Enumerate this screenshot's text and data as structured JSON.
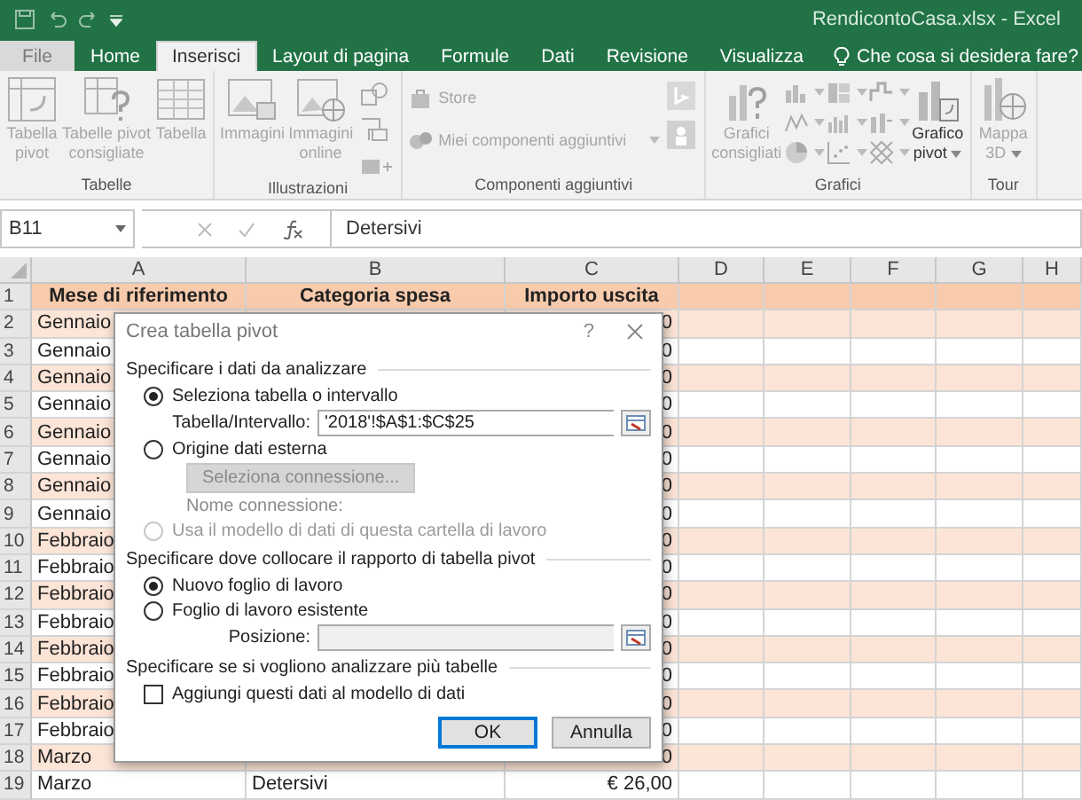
{
  "window": {
    "title": "RendicontoCasa.xlsx - Excel"
  },
  "tabs": [
    {
      "label": "File",
      "kind": "file",
      "selected": false
    },
    {
      "label": "Home",
      "kind": "tab",
      "selected": false
    },
    {
      "label": "Inserisci",
      "kind": "tab",
      "selected": true
    },
    {
      "label": "Layout di pagina",
      "kind": "tab",
      "selected": false
    },
    {
      "label": "Formule",
      "kind": "tab",
      "selected": false
    },
    {
      "label": "Dati",
      "kind": "tab",
      "selected": false
    },
    {
      "label": "Revisione",
      "kind": "tab",
      "selected": false
    },
    {
      "label": "Visualizza",
      "kind": "tab",
      "selected": false
    }
  ],
  "tell_me": {
    "placeholder": "Che cosa si desidera fare?"
  },
  "ribbon": {
    "groups": [
      {
        "label": "Tabelle",
        "items": [
          {
            "kind": "large",
            "label": "Tabella\npivot",
            "disabled": true
          },
          {
            "kind": "large",
            "label": "Tabelle pivot\nconsigliate",
            "disabled": true
          },
          {
            "kind": "large",
            "label": "Tabella",
            "disabled": true
          }
        ]
      },
      {
        "label": "Illustrazioni",
        "items": [
          {
            "kind": "large",
            "label": "Immagini",
            "disabled": true
          },
          {
            "kind": "large",
            "label": "Immagini\nonline",
            "disabled": true
          },
          {
            "kind": "icon-column"
          }
        ]
      },
      {
        "label": "Componenti aggiuntivi",
        "items": [
          {
            "kind": "small",
            "label": "Store",
            "disabled": true
          },
          {
            "kind": "small",
            "label": "Miei componenti aggiuntivi",
            "disabled": true,
            "dropdown": true
          },
          {
            "kind": "icon-column"
          }
        ]
      },
      {
        "label": "Grafici",
        "items": [
          {
            "kind": "large",
            "label": "Grafici\nconsigliati",
            "disabled": true
          },
          {
            "kind": "chart-grid"
          },
          {
            "kind": "large",
            "label": "Grafico\npivot",
            "disabled": false,
            "dropdown": true
          }
        ]
      },
      {
        "label": "Tour",
        "items": [
          {
            "kind": "large",
            "label": "Mappa\n3D",
            "disabled": true,
            "dropdown": true
          }
        ]
      }
    ]
  },
  "formula_bar": {
    "name_box": "B11",
    "formula": "Detersivi"
  },
  "sheet": {
    "columns": [
      "A",
      "B",
      "C",
      "D",
      "E",
      "F",
      "G",
      "H"
    ],
    "rows": [
      {
        "number": "1",
        "kind": "header",
        "cells": {
          "A": "Mese di riferimento",
          "B": "Categoria spesa",
          "C": "Importo uscita"
        }
      },
      {
        "number": "2",
        "kind": "band",
        "cells": {
          "A": "Gennaio",
          "C": "0"
        }
      },
      {
        "number": "3",
        "kind": "plain",
        "cells": {
          "A": "Gennaio",
          "C": "0"
        }
      },
      {
        "number": "4",
        "kind": "band",
        "cells": {
          "A": "Gennaio",
          "C": "0"
        }
      },
      {
        "number": "5",
        "kind": "plain",
        "cells": {
          "A": "Gennaio",
          "C": "0"
        }
      },
      {
        "number": "6",
        "kind": "band",
        "cells": {
          "A": "Gennaio",
          "C": "0"
        }
      },
      {
        "number": "7",
        "kind": "plain",
        "cells": {
          "A": "Gennaio",
          "C": "0"
        }
      },
      {
        "number": "8",
        "kind": "band",
        "cells": {
          "A": "Gennaio",
          "C": "0"
        }
      },
      {
        "number": "9",
        "kind": "plain",
        "cells": {
          "A": "Gennaio",
          "C": "0"
        }
      },
      {
        "number": "10",
        "kind": "band",
        "cells": {
          "A": "Febbraio",
          "C": "0"
        }
      },
      {
        "number": "11",
        "kind": "plain",
        "cells": {
          "A": "Febbraio",
          "C": "0"
        }
      },
      {
        "number": "12",
        "kind": "band",
        "cells": {
          "A": "Febbraio",
          "C": "0"
        }
      },
      {
        "number": "13",
        "kind": "plain",
        "cells": {
          "A": "Febbraio",
          "C": "0"
        }
      },
      {
        "number": "14",
        "kind": "band",
        "cells": {
          "A": "Febbraio",
          "C": "0"
        }
      },
      {
        "number": "15",
        "kind": "plain",
        "cells": {
          "A": "Febbraio",
          "C": "0"
        }
      },
      {
        "number": "16",
        "kind": "band",
        "cells": {
          "A": "Febbraio",
          "C": "0"
        }
      },
      {
        "number": "17",
        "kind": "plain",
        "cells": {
          "A": "Febbraio",
          "C": "0"
        }
      },
      {
        "number": "18",
        "kind": "band",
        "cells": {
          "A": "Marzo",
          "C": "0"
        }
      },
      {
        "number": "19",
        "kind": "plain",
        "cells": {
          "A": "Marzo",
          "B": "Detersivi",
          "C": "€ 26,00"
        }
      }
    ]
  },
  "dialog": {
    "title": "Crea tabella pivot",
    "help": "?",
    "sections": [
      {
        "heading": "Specificare i dati da analizzare",
        "items": [
          {
            "kind": "radio",
            "label": "Seleziona tabella o intervallo",
            "selected": true,
            "disabled": false
          },
          {
            "kind": "field",
            "label": "Tabella/Intervallo:",
            "value": "'2018'!$A$1:$C$25",
            "disabled": false
          },
          {
            "kind": "radio",
            "label": "Origine dati esterna",
            "selected": false,
            "disabled": false
          },
          {
            "kind": "button",
            "label": "Seleziona connessione...",
            "disabled": true
          },
          {
            "kind": "note",
            "label": "Nome connessione:",
            "disabled": true
          },
          {
            "kind": "radio",
            "label": "Usa il modello di dati di questa cartella di lavoro",
            "selected": false,
            "disabled": true
          }
        ]
      },
      {
        "heading": "Specificare dove collocare il rapporto di tabella pivot",
        "items": [
          {
            "kind": "radio",
            "label": "Nuovo foglio di lavoro",
            "selected": true,
            "disabled": false
          },
          {
            "kind": "radio",
            "label": "Foglio di lavoro esistente",
            "selected": false,
            "disabled": false
          },
          {
            "kind": "field",
            "label": "Posizione:",
            "disabled": true
          }
        ]
      },
      {
        "heading": "Specificare se si vogliono analizzare più tabelle",
        "items": [
          {
            "kind": "checkbox",
            "label": "Aggiungi questi dati al modello di dati",
            "checked": false,
            "disabled": false
          }
        ]
      }
    ],
    "buttons": [
      {
        "label": "OK",
        "default": true
      },
      {
        "label": "Annulla",
        "default": false
      }
    ]
  }
}
